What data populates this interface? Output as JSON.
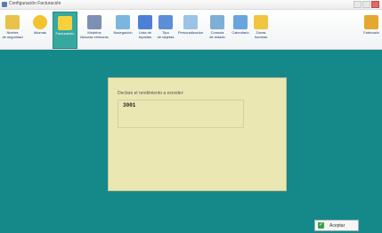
{
  "window": {
    "title": "Configuración Facturación"
  },
  "toolbar": {
    "items": [
      {
        "label": "Niveles\nde seguridad",
        "icon": "security-icon",
        "color": "#e8c24a"
      },
      {
        "label": "Idiomas",
        "icon": "globe-icon",
        "color": "#f2c230"
      },
      {
        "label": "Facturación",
        "icon": "invoice-icon",
        "color": "#f5d23d"
      },
      {
        "label": "Modelos\nfacturas emisoras",
        "icon": "document-models-icon",
        "color": "#7e8fb4"
      },
      {
        "label": "Navegación",
        "icon": "navigation-icon",
        "color": "#7bb6de"
      },
      {
        "label": "Lista de\ntopadas",
        "icon": "list-icon",
        "color": "#4e7fd6"
      },
      {
        "label": "Tipo\nde tarjetas",
        "icon": "cards-icon",
        "color": "#5b8ed6"
      },
      {
        "label": "Personalización",
        "icon": "personalize-icon",
        "color": "#9bc3e8"
      },
      {
        "label": "Consola\nde estado",
        "icon": "status-console-icon",
        "color": "#7faed6"
      },
      {
        "label": "Calendario",
        "icon": "calendar-icon",
        "color": "#6aa4e0"
      },
      {
        "label": "Zonas\nhorarias",
        "icon": "timezone-icon",
        "color": "#f0c640"
      },
      {
        "label": "Fabricado",
        "icon": "factory-icon",
        "color": "#e2a830"
      }
    ]
  },
  "dialog": {
    "prompt": "Declare el rendimiento a exceder:",
    "value": "3001"
  },
  "accept_button": {
    "label": "Aceptar"
  },
  "colors": {
    "background": "#15898a",
    "dialog": "#ebe7b3",
    "active_tab": "#37a8a0"
  }
}
